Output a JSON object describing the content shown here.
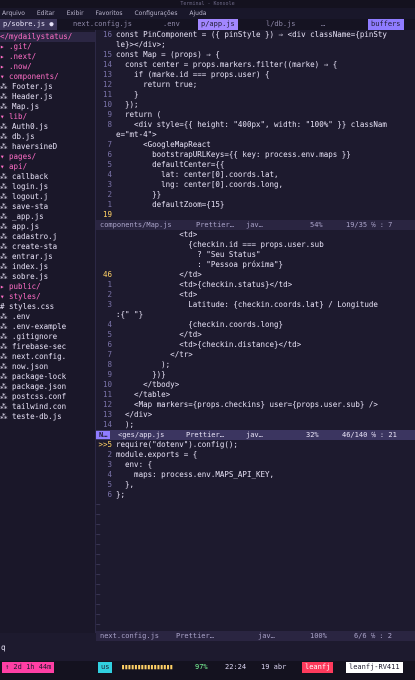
{
  "window": {
    "title": "Terminal - Konsole"
  },
  "menu": [
    "Arquivo",
    "Editar",
    "Exibir",
    "Favoritos",
    "Configurações",
    "Ajuda"
  ],
  "tabs": [
    {
      "label": "p/sobre.js ●",
      "state": "sel"
    },
    {
      "label": "next.config.js",
      "state": "normal"
    },
    {
      "label": ".env",
      "state": "normal"
    },
    {
      "label": "p/app.js",
      "state": "cur"
    },
    {
      "label": "l/db.js",
      "state": "normal"
    },
    {
      "label": "…",
      "state": "normal"
    },
    {
      "label": "buffers",
      "state": "buf"
    }
  ],
  "tree": [
    {
      "text": "</mydailystatus/",
      "type": "sel"
    },
    {
      "text": " ▸  .git/",
      "type": "dir"
    },
    {
      "text": " ▸  .next/",
      "type": "dir"
    },
    {
      "text": " ▸  .now/",
      "type": "dir"
    },
    {
      "text": " ▾  components/",
      "type": "dir"
    },
    {
      "text": "     ⁂ Footer.js",
      "type": "file"
    },
    {
      "text": "     ⁂ Header.js",
      "type": "file"
    },
    {
      "text": "     ⁂ Map.js",
      "type": "file"
    },
    {
      "text": " ▾  lib/",
      "type": "dir"
    },
    {
      "text": "     ⁂ Auth0.js",
      "type": "file"
    },
    {
      "text": "     ⁂ db.js",
      "type": "file"
    },
    {
      "text": "     ⁂ haversineD",
      "type": "file"
    },
    {
      "text": " ▾  pages/",
      "type": "dir"
    },
    {
      "text": "   ▾  api/",
      "type": "dir"
    },
    {
      "text": "       ⁂ callback",
      "type": "file"
    },
    {
      "text": "       ⁂ login.js",
      "type": "file"
    },
    {
      "text": "       ⁂ logout.j",
      "type": "file"
    },
    {
      "text": "       ⁂ save-sta",
      "type": "file"
    },
    {
      "text": "     ⁂ _app.js",
      "type": "file"
    },
    {
      "text": "     ⁂ app.js",
      "type": "file"
    },
    {
      "text": "     ⁂ cadastro.j",
      "type": "file"
    },
    {
      "text": "     ⁂ create-sta",
      "type": "file"
    },
    {
      "text": "     ⁂ entrar.js",
      "type": "file"
    },
    {
      "text": "     ⁂ index.js",
      "type": "file"
    },
    {
      "text": "     ⁂ sobre.js",
      "type": "file"
    },
    {
      "text": " ▸  public/",
      "type": "dir"
    },
    {
      "text": " ▾  styles/",
      "type": "dir"
    },
    {
      "text": "     # styles.css",
      "type": "file"
    },
    {
      "text": "   ⁂ .env",
      "type": "file"
    },
    {
      "text": "   ⁂ .env-example",
      "type": "file"
    },
    {
      "text": "   ⁂ .gitignore",
      "type": "file"
    },
    {
      "text": "   ⁂ firebase-sec",
      "type": "file"
    },
    {
      "text": "   ⁂ next.config.",
      "type": "file"
    },
    {
      "text": "   ⁂ now.json",
      "type": "file"
    },
    {
      "text": "   ⁂ package-lock",
      "type": "file"
    },
    {
      "text": "   ⁂ package.json",
      "type": "file"
    },
    {
      "text": "   ⁂ postcss.conf",
      "type": "file"
    },
    {
      "text": "   ⁂ tailwind.con",
      "type": "file"
    },
    {
      "text": "   ⁂ teste-db.js",
      "type": "file"
    }
  ],
  "pane1": {
    "lines": [
      {
        "n": "16",
        "t": "const PinComponent = ({ pinStyle }) ⇒ <div className={pinSty"
      },
      {
        "n": "",
        "t": "le}></div>;"
      },
      {
        "n": "15",
        "t": "const Map = (props) ⇒ {"
      },
      {
        "n": "14",
        "t": "  const center = props.markers.filter((marke) ⇒ {"
      },
      {
        "n": "13",
        "t": "    if (marke.id === props.user) {"
      },
      {
        "n": "12",
        "t": "      return true;"
      },
      {
        "n": "11",
        "t": "    }"
      },
      {
        "n": "10",
        "t": "  });"
      },
      {
        "n": "9",
        "t": "  return ("
      },
      {
        "n": "8",
        "t": "    <div style={{ height: \"400px\", width: \"100%\" }} classNam"
      },
      {
        "n": "",
        "t": "e=\"mt-4\">"
      },
      {
        "n": "7",
        "t": "      <GoogleMapReact"
      },
      {
        "n": "6",
        "t": "        bootstrapURLKeys={{ key: process.env.maps }}"
      },
      {
        "n": "5",
        "t": "        defaultCenter={{"
      },
      {
        "n": "4",
        "t": "          lat: center[0].coords.lat,"
      },
      {
        "n": "3",
        "t": "          lng: center[0].coords.long,"
      },
      {
        "n": "2",
        "t": "        }}"
      },
      {
        "n": "1",
        "t": "        defaultZoom={15}"
      },
      {
        "n": "19",
        "t": ""
      }
    ],
    "status": {
      "file": "components/Map.js",
      "ft": "Prettier…",
      "lang": "jav…",
      "pct": "54%",
      "pos": "19/35 ℅ : 7"
    }
  },
  "pane2": {
    "lines": [
      {
        "n": "",
        "t": "              <td>"
      },
      {
        "n": "",
        "t": "                {checkin.id === props.user.sub"
      },
      {
        "n": "",
        "t": "                  ? \"Seu Status\""
      },
      {
        "n": "",
        "t": "                  : \"Pessoa próxima\"}"
      },
      {
        "n": "46",
        "t": "              </td>"
      },
      {
        "n": "1",
        "t": "              <td>{checkin.status}</td>"
      },
      {
        "n": "2",
        "t": "              <td>"
      },
      {
        "n": "3",
        "t": "                Latitude: {checkin.coords.lat} / Longitude"
      },
      {
        "n": "",
        "t": ":{\" \"}"
      },
      {
        "n": "4",
        "t": "                {checkin.coords.long}"
      },
      {
        "n": "5",
        "t": "              </td>"
      },
      {
        "n": "6",
        "t": "              <td>{checkin.distance}</td>"
      },
      {
        "n": "7",
        "t": "            </tr>"
      },
      {
        "n": "8",
        "t": "          );"
      },
      {
        "n": "9",
        "t": "        })}"
      },
      {
        "n": "10",
        "t": "      </tbody>"
      },
      {
        "n": "11",
        "t": "    </table>"
      },
      {
        "n": "12",
        "t": "    <Map markers={props.checkins} user={props.user.sub} />"
      },
      {
        "n": "13",
        "t": "  </div>"
      },
      {
        "n": "14",
        "t": "  );"
      }
    ],
    "status": {
      "mode": "N…",
      "file": "<ges/app.js",
      "ft": "Prettier…",
      "lang": "jav…",
      "pct": "32%",
      "pos": "46/140 ℅ : 21"
    }
  },
  "pane3": {
    "lines": [
      {
        "n": ">>5",
        "t": "require(\"dotenv\").config();"
      },
      {
        "n": "2",
        "t": "module.exports = {"
      },
      {
        "n": "3",
        "t": "  env: {"
      },
      {
        "n": "4",
        "t": "    maps: process.env.MAPS_API_KEY,"
      },
      {
        "n": "5",
        "t": "  },"
      },
      {
        "n": "6",
        "t": "};"
      }
    ],
    "status": {
      "file": "next.config.js",
      "ft": "Prettier…",
      "lang": "jav…",
      "pct": "100%",
      "pos": "6/6 ℅ : 2"
    }
  },
  "cmdline": {
    "text": "q"
  },
  "tmux": {
    "left": "↑ 2d 1h 44m",
    "session": "us",
    "battery": "97%",
    "time": "22:24",
    "date": "19 abr",
    "user": "leanfj",
    "host": "leanfj-RV411"
  }
}
